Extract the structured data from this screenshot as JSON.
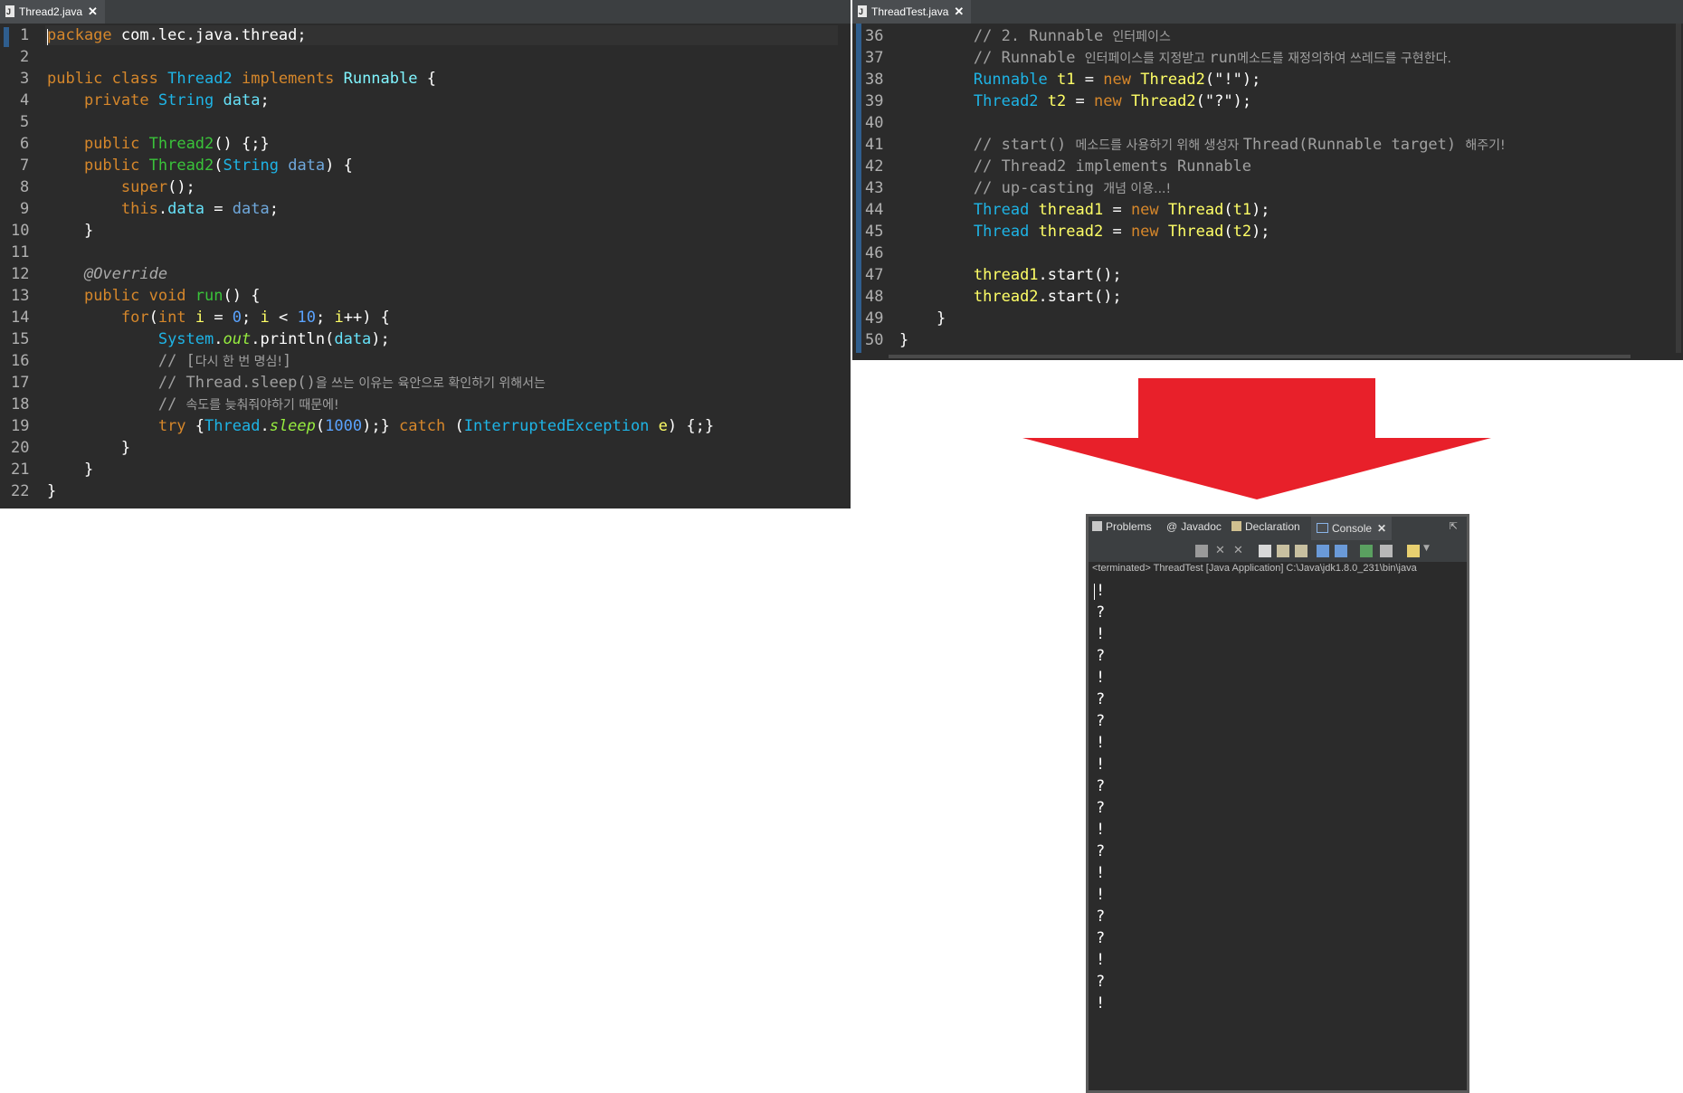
{
  "left_editor": {
    "tab_label": "Thread2.java",
    "line_numbers": [
      "1",
      "2",
      "3",
      "4",
      "5",
      "6",
      "7",
      "8",
      "9",
      "10",
      "11",
      "12",
      "13",
      "14",
      "15",
      "16",
      "17",
      "18",
      "19",
      "20",
      "21",
      "22"
    ]
  },
  "right_editor": {
    "tab_label": "ThreadTest.java",
    "line_numbers": [
      "36",
      "37",
      "38",
      "39",
      "40",
      "41",
      "42",
      "43",
      "44",
      "45",
      "46",
      "47",
      "48",
      "49",
      "50"
    ]
  },
  "console": {
    "tabs": [
      "Problems",
      "Javadoc",
      "Declaration",
      "Console"
    ],
    "terminated_text": "<terminated> ThreadTest [Java Application] C:\\Java\\jdk1.8.0_231\\bin\\java",
    "output_lines": [
      "!",
      "?",
      "!",
      "?",
      "!",
      "?",
      "?",
      "!",
      "!",
      "?",
      "?",
      "!",
      "?",
      "!",
      "!",
      "?",
      "?",
      "!",
      "?",
      "!"
    ]
  },
  "arrow_color": "#e8202a"
}
